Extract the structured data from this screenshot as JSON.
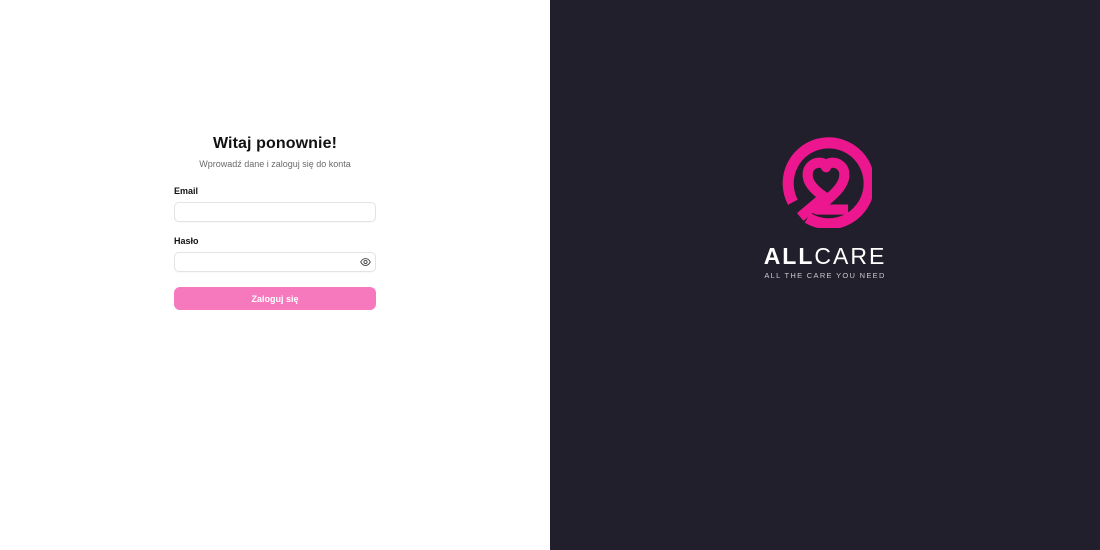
{
  "login": {
    "title": "Witaj ponownie!",
    "subtitle": "Wprowadź dane i zaloguj się do konta",
    "email_label": "Email",
    "email_value": "",
    "password_label": "Hasło",
    "password_value": "",
    "password_toggle_icon": "eye-icon",
    "submit_label": "Zaloguj się"
  },
  "brand": {
    "name_bold": "ALL",
    "name_light": "CARE",
    "tagline": "ALL THE CARE YOU NEED",
    "logo_icon": "heart-circle-logo"
  },
  "colors": {
    "accent": "#f779bd",
    "brand_pink": "#ec178e",
    "dark_panel": "#211f2b"
  }
}
